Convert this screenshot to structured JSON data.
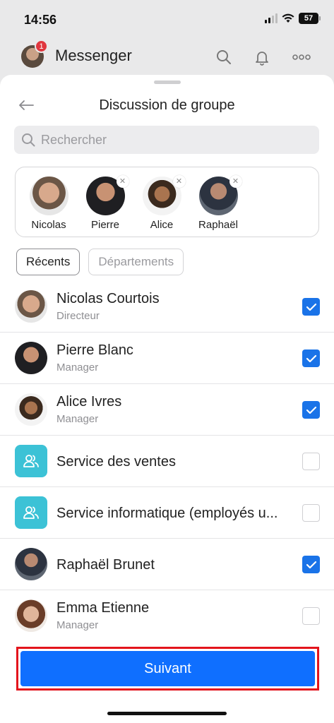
{
  "status_bar": {
    "time": "14:56",
    "battery": "57"
  },
  "app_header": {
    "title": "Messenger",
    "notification_count": "1",
    "icons": [
      "search-icon",
      "bell-icon",
      "more-icon"
    ]
  },
  "sheet": {
    "title": "Discussion de groupe",
    "search_placeholder": "Rechercher",
    "selected": [
      {
        "label": "Nicolas",
        "removable": false
      },
      {
        "label": "Pierre",
        "removable": true
      },
      {
        "label": "Alice",
        "removable": true
      },
      {
        "label": "Raphaël",
        "removable": true
      }
    ],
    "tabs": [
      {
        "label": "Récents",
        "active": true
      },
      {
        "label": "Départements",
        "active": false
      }
    ],
    "list": [
      {
        "name": "Nicolas Courtois",
        "role": "Directeur",
        "type": "person",
        "checked": true
      },
      {
        "name": "Pierre Blanc",
        "role": "Manager",
        "type": "person",
        "checked": true
      },
      {
        "name": "Alice Ivres",
        "role": "Manager",
        "type": "person",
        "checked": true
      },
      {
        "name": "Service des ventes",
        "role": "",
        "type": "department",
        "checked": false
      },
      {
        "name": "Service informatique (employés u...",
        "role": "",
        "type": "department",
        "checked": false
      },
      {
        "name": "Raphaël Brunet",
        "role": "",
        "type": "person",
        "checked": true
      },
      {
        "name": "Emma Etienne",
        "role": "Manager",
        "type": "person",
        "checked": false
      }
    ],
    "next_button": "Suivant"
  },
  "colors": {
    "accent": "#0F6FFF",
    "checkbox": "#1A73E8",
    "department": "#3CC2D6",
    "highlight": "#E3141C",
    "badge": "#E0363E"
  }
}
